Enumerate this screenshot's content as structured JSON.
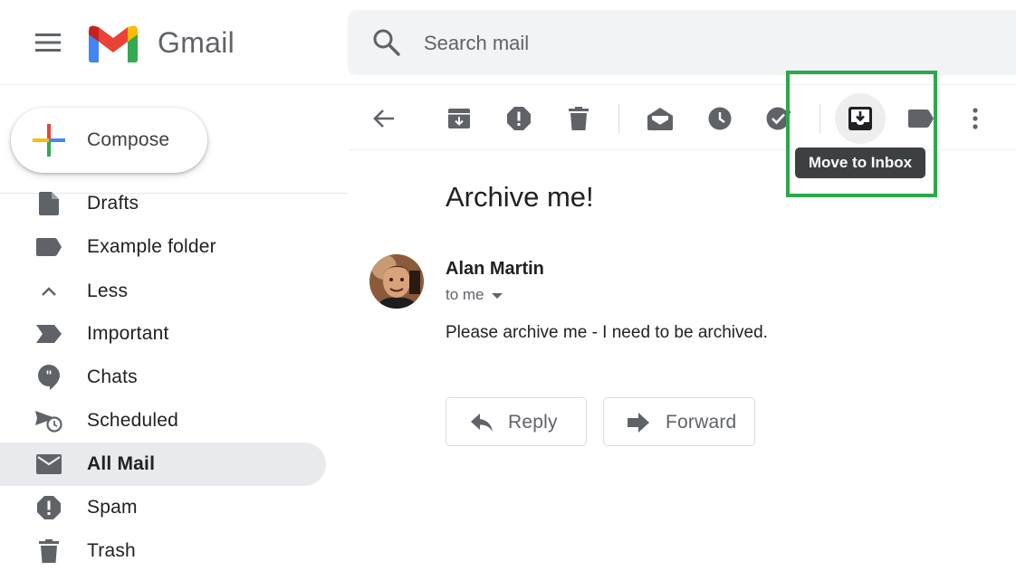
{
  "app": {
    "name": "Gmail"
  },
  "search": {
    "placeholder": "Search mail"
  },
  "compose": {
    "label": "Compose"
  },
  "sidebar": {
    "items": [
      {
        "label": "Drafts",
        "icon": "draft-icon",
        "active": false
      },
      {
        "label": "Example folder",
        "icon": "label-icon",
        "active": false
      },
      {
        "label": "Less",
        "icon": "chevron-up-icon",
        "active": false
      },
      {
        "label": "Important",
        "icon": "important-icon",
        "active": false
      },
      {
        "label": "Chats",
        "icon": "chat-icon",
        "active": false
      },
      {
        "label": "Scheduled",
        "icon": "scheduled-send-icon",
        "active": false
      },
      {
        "label": "All Mail",
        "icon": "mail-icon",
        "active": true
      },
      {
        "label": "Spam",
        "icon": "spam-icon",
        "active": false
      },
      {
        "label": "Trash",
        "icon": "trash-icon",
        "active": false
      }
    ]
  },
  "toolbar": {
    "buttons": [
      "back-arrow-icon",
      "archive-icon",
      "report-spam-icon",
      "delete-icon",
      "mark-unread-icon",
      "snooze-icon",
      "add-to-tasks-icon",
      "move-to-inbox-icon",
      "labels-icon",
      "more-vert-icon"
    ],
    "tooltip": "Move to Inbox"
  },
  "message": {
    "subject": "Archive me!",
    "sender": "Alan Martin",
    "recipient": "to me",
    "body": "Please archive me - I need to be archived."
  },
  "actions": {
    "reply": "Reply",
    "forward": "Forward"
  },
  "colors": {
    "highlight": "#2aa84a",
    "tooltip_bg": "#3c4043",
    "active_nav": "#e8eaed",
    "search_bg": "#f1f3f4",
    "icon_grey": "#5f6368"
  }
}
